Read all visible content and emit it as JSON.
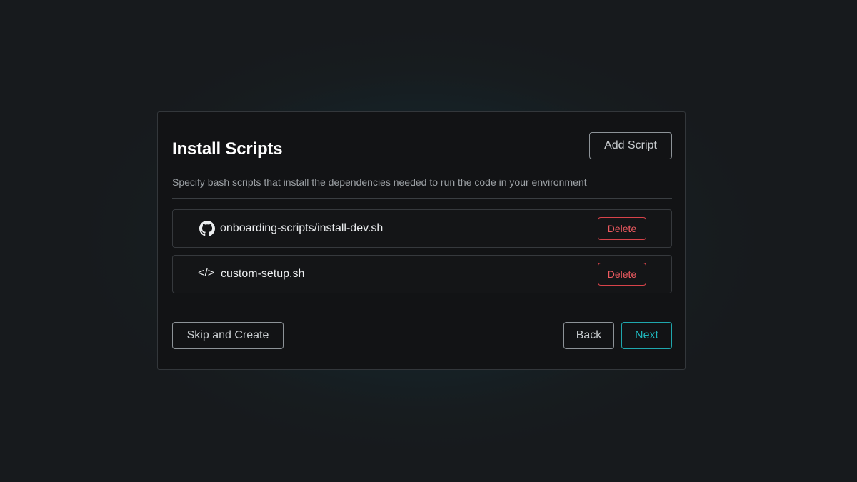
{
  "dialog": {
    "title": "Install Scripts",
    "add_button_label": "Add Script",
    "subtitle": "Specify bash scripts that install the dependencies needed to run the code in your environment",
    "scripts": [
      {
        "icon": "github-icon",
        "name": "onboarding-scripts/install-dev.sh",
        "delete_label": "Delete"
      },
      {
        "icon": "code-icon",
        "icon_text": "</>",
        "name": "custom-setup.sh",
        "delete_label": "Delete"
      }
    ],
    "footer": {
      "skip_label": "Skip and Create",
      "back_label": "Back",
      "next_label": "Next"
    }
  },
  "colors": {
    "accent": "#1fb5bb",
    "danger": "#ee5a60",
    "panel_bg": "#121315",
    "page_bg": "#171a1d"
  }
}
